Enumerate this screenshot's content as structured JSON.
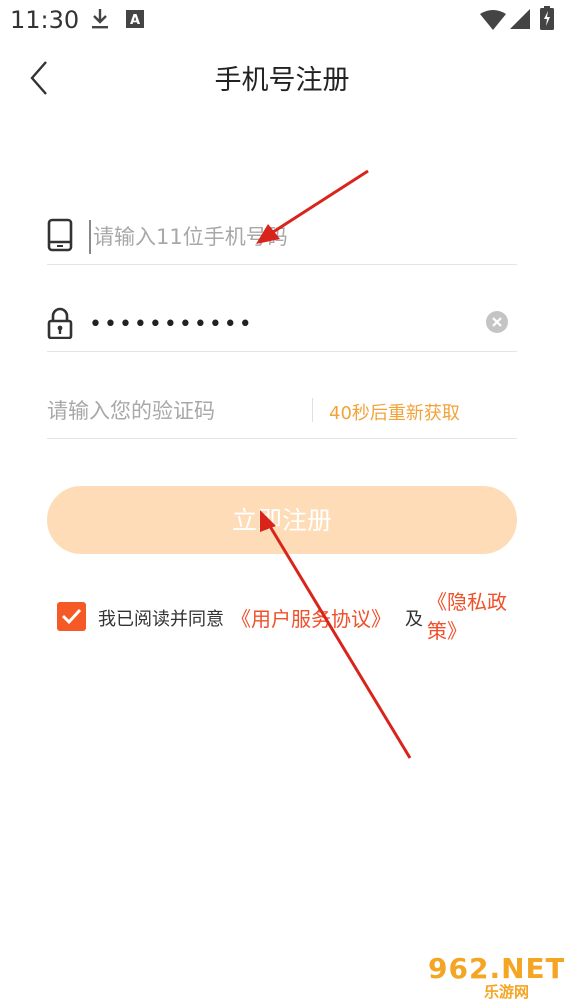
{
  "status_bar": {
    "time": "11:30",
    "icons": [
      "download-icon",
      "accessibility-icon",
      "wifi-icon",
      "signal-icon",
      "battery-charging-icon"
    ]
  },
  "header": {
    "title": "手机号注册",
    "back_icon": "chevron-left-icon"
  },
  "form": {
    "phone": {
      "icon": "phone-icon",
      "value": "",
      "placeholder": "请输入11位手机号码"
    },
    "password": {
      "icon": "lock-icon",
      "value": "•••••••••••",
      "clear_icon": "clear-icon"
    },
    "code": {
      "value": "",
      "placeholder": "请输入您的验证码",
      "resend_label": "40秒后重新获取"
    },
    "register_label": "立即注册"
  },
  "agreement": {
    "checked": true,
    "text": "我已阅读并同意",
    "terms_link": "《用户服务协议》",
    "and": "及",
    "privacy_link": "《隐私政策》"
  },
  "watermark": {
    "main": "962.NET",
    "sub": "乐游网"
  },
  "colors": {
    "accent": "#f2a33a",
    "link": "#f0502a",
    "checkbox": "#f55a26",
    "button_disabled": "#fedcb7",
    "annotation_arrow": "#d9241c"
  }
}
